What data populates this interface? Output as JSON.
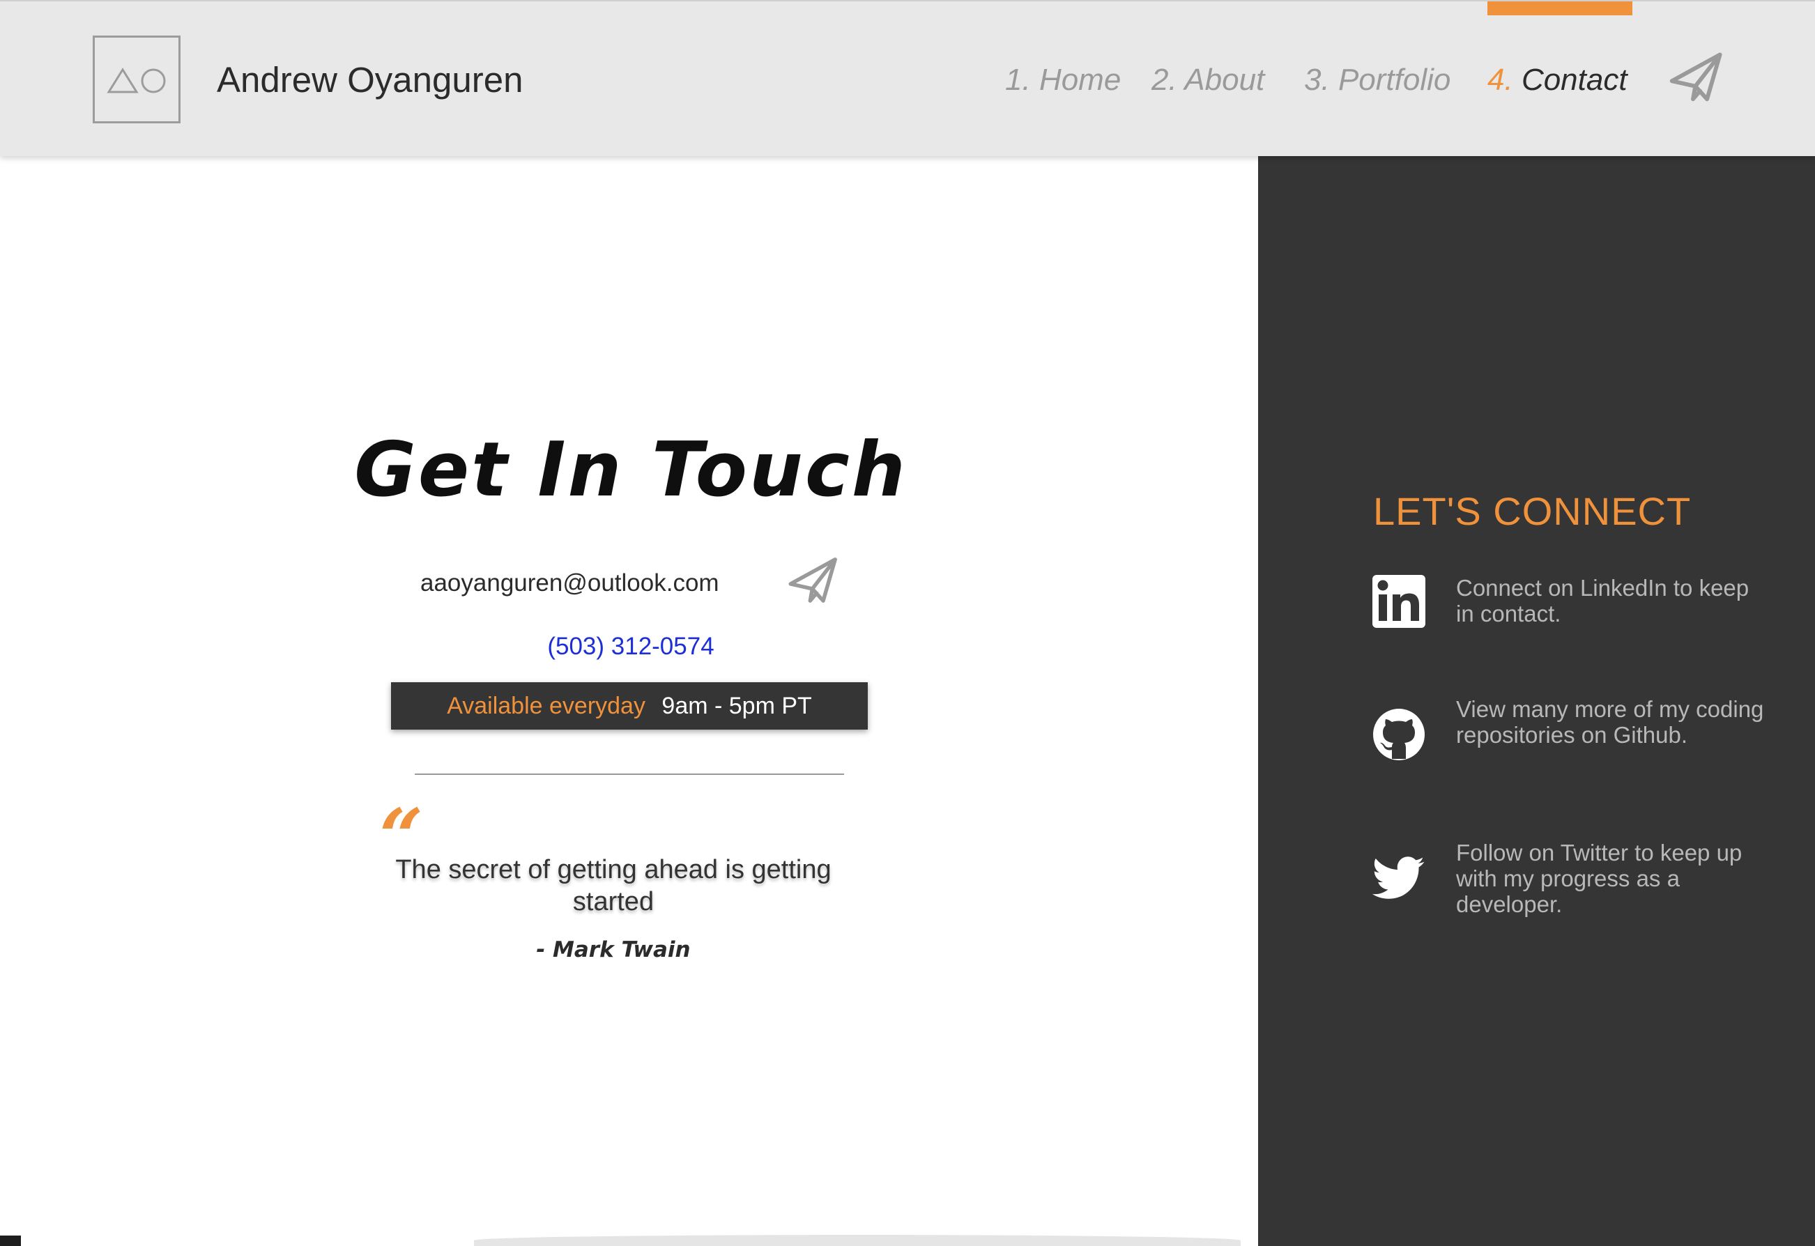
{
  "header": {
    "logo_label": "△○",
    "site_name": "Andrew Oyanguren",
    "nav": [
      {
        "num": "1.",
        "label": "Home"
      },
      {
        "num": "2.",
        "label": "About"
      },
      {
        "num": "3.",
        "label": "Portfolio"
      },
      {
        "num": "4.",
        "label": "Contact"
      }
    ],
    "active_nav": "Contact"
  },
  "contact": {
    "title": "Get In Touch",
    "email": "aaoyanguren@outlook.com",
    "phone": "(503) 312-0574",
    "hours_label": "Available everyday",
    "hours_time": "9am - 5pm PT"
  },
  "quote": {
    "mark": "“",
    "text": "The secret of getting ahead is getting started",
    "author": "- Mark Twain"
  },
  "sidebar": {
    "title": "LET'S CONNECT",
    "items": [
      {
        "icon": "linkedin-icon",
        "text": "Connect on LinkedIn to keep in contact."
      },
      {
        "icon": "github-icon",
        "text": "View many more of my coding repositories on Github."
      },
      {
        "icon": "twitter-icon",
        "text": "Follow on Twitter to keep up with my progress as a developer."
      }
    ]
  },
  "colors": {
    "accent": "#f0923b",
    "header_bg": "#e8e8e8",
    "sidebar_bg": "#353535",
    "link": "#1c2fd6"
  }
}
